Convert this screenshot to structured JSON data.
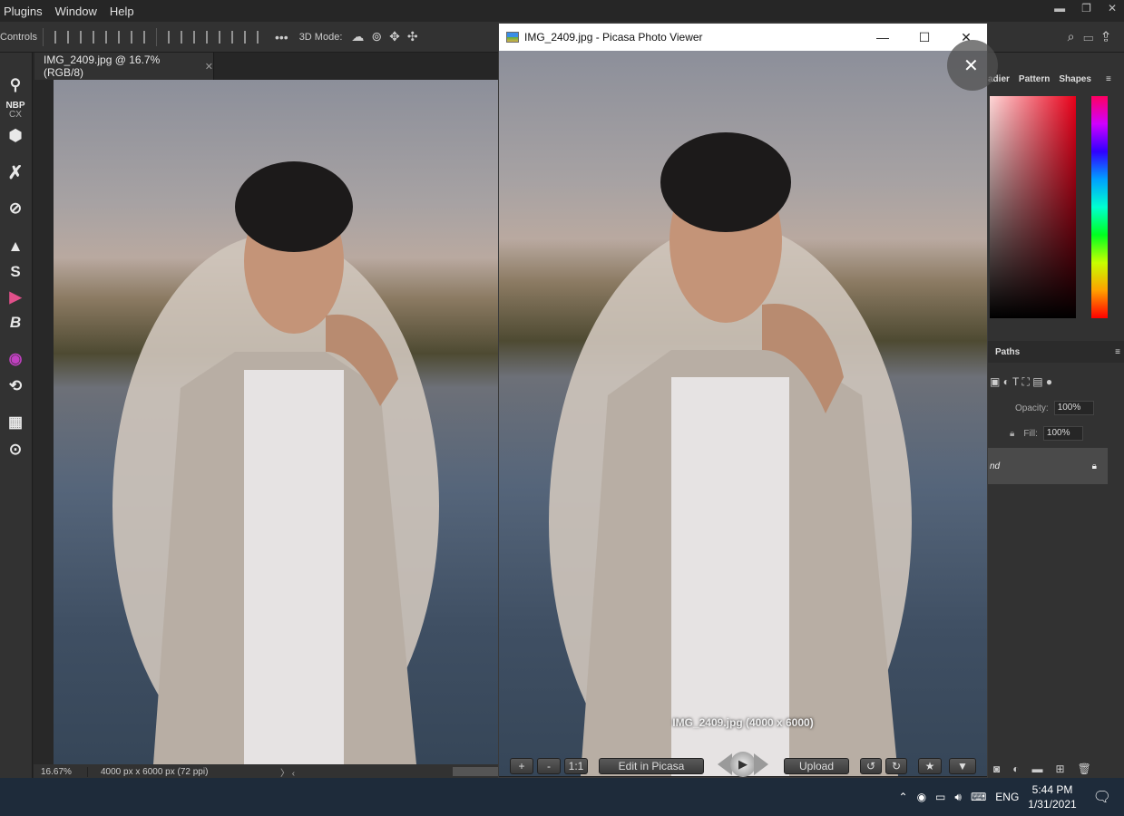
{
  "menubar": {
    "items": [
      "Plugins",
      "Window",
      "Help"
    ]
  },
  "optionsbar": {
    "left_label": "Controls",
    "mode_label": "3D Mode:",
    "more": "•••"
  },
  "document": {
    "tab_title": "IMG_2409.jpg @ 16.7% (RGB/8)",
    "zoom": "16.67%",
    "info": "4000 px x 6000 px (72 ppi)"
  },
  "tools": {
    "nbp_label": "NBP",
    "cx_label": "CX"
  },
  "panels": {
    "tabs": [
      "adier",
      "Pattern",
      "Shapes"
    ],
    "paths_tab": "Paths",
    "opacity_label": "Opacity:",
    "opacity_value": "100%",
    "fill_label": "Fill:",
    "fill_value": "100%",
    "layer_name": "nd"
  },
  "picasa": {
    "title": "IMG_2409.jpg - Picasa Photo Viewer",
    "caption": "IMG_2409.jpg (4000 x 6000)",
    "zoom_in": "+",
    "zoom_out": "-",
    "one_to_one": "1:1",
    "edit": "Edit in Picasa",
    "upload": "Upload"
  },
  "taskbar": {
    "lang": "ENG",
    "time": "5:44 PM",
    "date": "1/31/2021"
  },
  "colors": {
    "ps_bg": "#262626",
    "panel": "#323232",
    "taskbar": "#1e2b3a"
  }
}
